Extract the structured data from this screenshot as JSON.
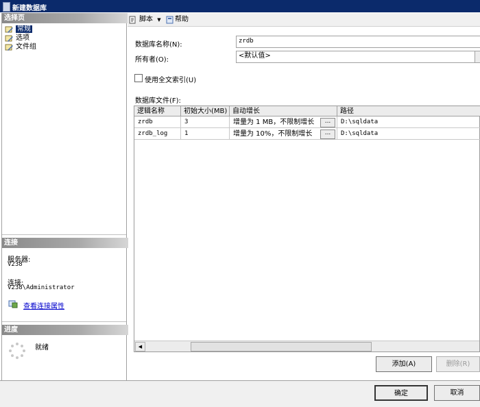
{
  "window": {
    "title": "新建数据库"
  },
  "left_pane": {
    "select_page_header": "选择页",
    "nav_items": [
      {
        "label": "常规",
        "selected": true
      },
      {
        "label": "选项",
        "selected": false
      },
      {
        "label": "文件组",
        "selected": false
      }
    ],
    "connection_header": "连接",
    "server_label": "服务器:",
    "server_value": "V238",
    "connection_label": "连接:",
    "connection_value": "V238\\Administrator",
    "view_props_link": "查看连接属性",
    "progress_header": "进度",
    "progress_status": "就绪"
  },
  "toolbar": {
    "script_label": "脚本",
    "help_label": "帮助"
  },
  "form": {
    "db_name_label": "数据库名称(N):",
    "db_name_value": "zrdb",
    "owner_label": "所有者(O):",
    "owner_value": "<默认值>",
    "fulltext_label": "使用全文索引(U)",
    "fulltext_checked": false,
    "db_files_label": "数据库文件(F):"
  },
  "files_table": {
    "columns": [
      "逻辑名称",
      "初始大小(MB)",
      "自动增长",
      "路径"
    ],
    "rows": [
      {
        "logical_name": "zrdb",
        "initial_size": "3",
        "autogrowth": "增量为 1 MB，不限制增长",
        "path": "D:\\sqldata"
      },
      {
        "logical_name": "zrdb_log",
        "initial_size": "1",
        "autogrowth": "增量为 10%，不限制增长",
        "path": "D:\\sqldata"
      }
    ],
    "ellipsis": "..."
  },
  "actions": {
    "add_label": "添加(A)",
    "remove_label": "删除(R)"
  },
  "bottom": {
    "ok_label": "确定",
    "cancel_label": "取消"
  },
  "colors": {
    "titlebar": "#0b2a6b",
    "link": "#0000cc"
  }
}
